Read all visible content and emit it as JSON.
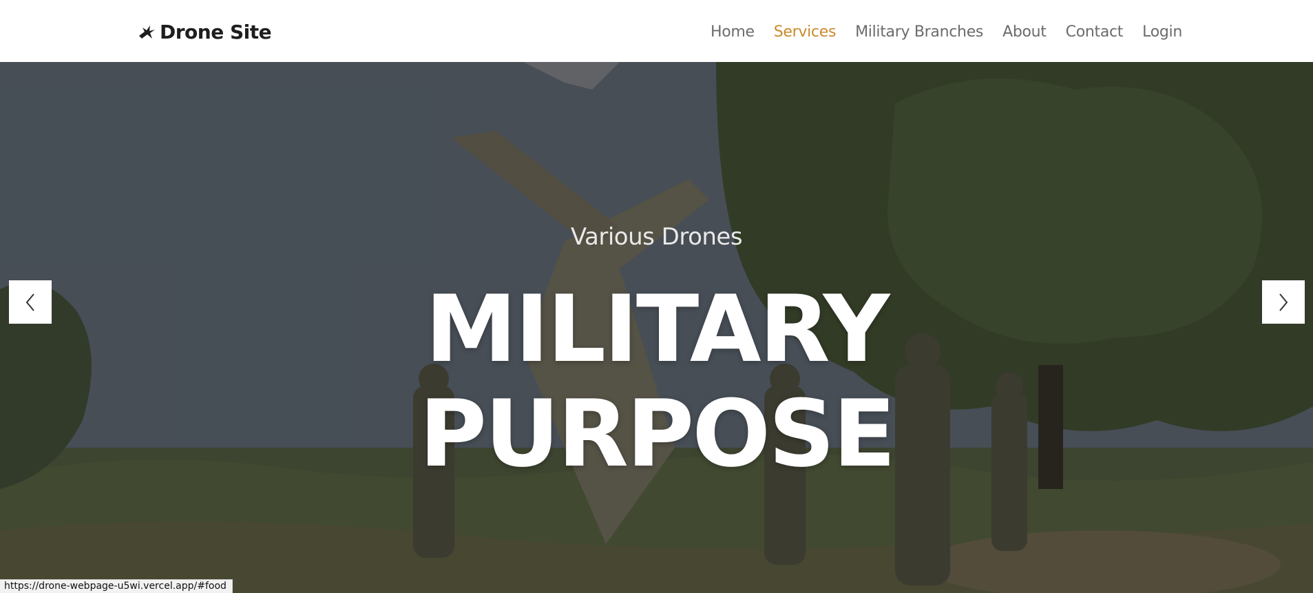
{
  "navbar": {
    "brand": "Drone Site",
    "brand_icon": "drone-icon",
    "links": [
      {
        "label": "Home",
        "active": false
      },
      {
        "label": "Services",
        "active": true
      },
      {
        "label": "Military Branches",
        "active": false
      },
      {
        "label": "About",
        "active": false
      },
      {
        "label": "Contact",
        "active": false
      },
      {
        "label": "Login",
        "active": false
      }
    ]
  },
  "hero": {
    "subtitle": "Various Drones",
    "title_line1": "MILITARY",
    "title_line2": "PURPOSE",
    "prev_icon": "chevron-left-icon",
    "next_icon": "chevron-right-icon"
  },
  "status_bar": {
    "url": "https://drone-webpage-u5wi.vercel.app/#food"
  },
  "colors": {
    "active_link": "#c98a2b",
    "nav_link": "#6b6b6b",
    "brand": "#1e1e1e"
  }
}
